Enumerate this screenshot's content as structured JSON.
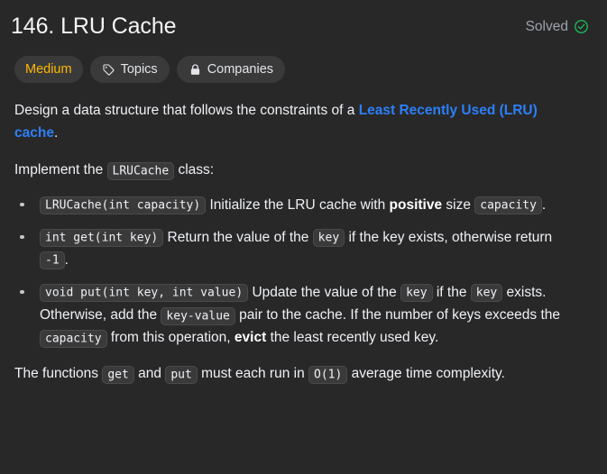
{
  "header": {
    "title": "146. LRU Cache",
    "status_label": "Solved",
    "status_icon": "check-circle-icon",
    "status_color": "#1cbe5d"
  },
  "badges": [
    {
      "label": "Medium",
      "icon": null,
      "kind": "difficulty",
      "color": "#ffb800"
    },
    {
      "label": "Topics",
      "icon": "tag-icon",
      "kind": "topics"
    },
    {
      "label": "Companies",
      "icon": "lock-icon",
      "kind": "companies"
    }
  ],
  "description": {
    "intro": {
      "before_link": "Design a data structure that follows the constraints of a ",
      "link_text": "Least Recently Used (LRU) cache",
      "after_link": "."
    },
    "implement": {
      "before": "Implement the ",
      "code": "LRUCache",
      "after": " class:"
    },
    "methods": [
      {
        "signature": "LRUCache(int capacity)",
        "parts": [
          {
            "type": "text",
            "value": " Initialize the LRU cache with "
          },
          {
            "type": "bold",
            "value": "positive"
          },
          {
            "type": "text",
            "value": " size "
          },
          {
            "type": "code",
            "value": "capacity"
          },
          {
            "type": "text",
            "value": "."
          }
        ]
      },
      {
        "signature": "int get(int key)",
        "parts": [
          {
            "type": "text",
            "value": " Return the value of the "
          },
          {
            "type": "code",
            "value": "key"
          },
          {
            "type": "text",
            "value": " if the key exists, otherwise return "
          },
          {
            "type": "code",
            "value": "-1"
          },
          {
            "type": "text",
            "value": "."
          }
        ]
      },
      {
        "signature": "void put(int key, int value)",
        "parts": [
          {
            "type": "text",
            "value": " Update the value of the "
          },
          {
            "type": "code",
            "value": "key"
          },
          {
            "type": "text",
            "value": " if the "
          },
          {
            "type": "code",
            "value": "key"
          },
          {
            "type": "text",
            "value": " exists. Otherwise, add the "
          },
          {
            "type": "code",
            "value": "key-value"
          },
          {
            "type": "text",
            "value": " pair to the cache. If the number of keys exceeds the "
          },
          {
            "type": "code",
            "value": "capacity"
          },
          {
            "type": "text",
            "value": " from this operation, "
          },
          {
            "type": "bold",
            "value": "evict"
          },
          {
            "type": "text",
            "value": " the least recently used key."
          }
        ]
      }
    ],
    "complexity": {
      "before_get": "The functions ",
      "code_get": "get",
      "between": " and ",
      "code_put": "put",
      "before_big_o": " must each run in ",
      "code_big_o": "O(1)",
      "after": " average time complexity."
    }
  }
}
